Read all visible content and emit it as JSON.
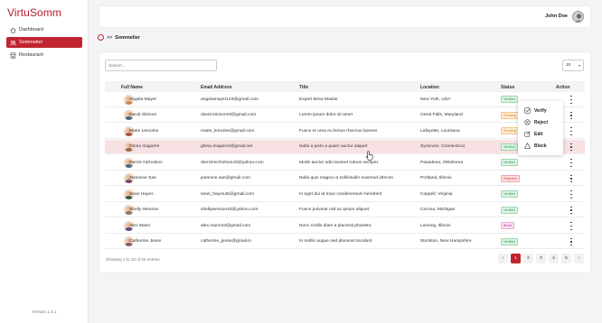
{
  "app": {
    "brand": "VirtuSomm",
    "version": "Version 1.3.1"
  },
  "sidebar": {
    "items": [
      {
        "label": "Dashboard",
        "icon": "home-icon",
        "active": false
      },
      {
        "label": "Sommelier",
        "icon": "users-icon",
        "active": true
      },
      {
        "label": "Restaurant",
        "icon": "store-icon",
        "active": false
      }
    ]
  },
  "header": {
    "user_name": "John Doe"
  },
  "breadcrumb": {
    "separator": ">>",
    "current": "Sommelier"
  },
  "table": {
    "search_placeholder": "Search...",
    "page_size": "10",
    "columns": [
      "Full Name",
      "Email Address",
      "Title",
      "Location",
      "Status",
      "Action"
    ],
    "rows": [
      {
        "name": "Angela Mayer",
        "email": "angelamayer143@gmail.com",
        "title": "Expert Brew Master",
        "location": "New York, USA",
        "status": "Verified"
      },
      {
        "name": "David Stinson",
        "email": "david.stinson19@gmail.com",
        "title": "Lorem ipsum dolor sit amet",
        "location": "Great Falls, Maryland",
        "status": "Pending"
      },
      {
        "name": "Marie Lemoine",
        "email": "marie_lemoine@gmail.com",
        "title": "Fusce et urna eu lectus rhoncus laoreet",
        "location": "Lafayette, Louisiana",
        "status": "Pending"
      },
      {
        "name": "Gloria Izaguirre",
        "email": "gloria-izaguirre@gmail.net",
        "title": "Nulla a justo a quam auctor aliquet",
        "location": "Syracuse, Connecticut",
        "status": "Verified"
      },
      {
        "name": "Derick Nicholson",
        "email": "derricknicholson43@yahoo.com",
        "title": "Morbi auctor odio laoreet rutrum semper",
        "location": "Pasadena, Oklahoma",
        "status": "Verified"
      },
      {
        "name": "Jeannine Sae",
        "email": "jeannine.sae@gmail.com",
        "title": "Nulla quis magna ut sollicitudin euismod ultrices",
        "location": "Portland, Illinois",
        "status": "Rejected"
      },
      {
        "name": "Sean Hayes",
        "email": "sean_hayes45@gmail.com",
        "title": "In eget dui at risus condimentum hendrerit",
        "location": "Coppell, Virginia",
        "status": "Verified"
      },
      {
        "name": "Shelly Wesson",
        "email": "shellywesson43@yahoo.com",
        "title": "Fusce pulvinar nisl ac ipsum aliquet",
        "location": "Corona, Michigan",
        "status": "Verified"
      },
      {
        "name": "Alex Mann",
        "email": "alex.mann43@gmail.com",
        "title": "Nunc mollis diam a placerat pharetra",
        "location": "Lansing, Illinois",
        "status": "Block"
      },
      {
        "name": "Catherine Jesse",
        "email": "catherine_jesse@gmail.in",
        "title": "In mollis augue sed placerat tincidunt",
        "location": "Stockton, New Hampshire",
        "status": "Verified"
      }
    ],
    "footer": "Showing 1 to 10 of 50 entries"
  },
  "action_menu": [
    {
      "label": "Verify",
      "icon": "check-square-icon"
    },
    {
      "label": "Reject",
      "icon": "x-circle-icon"
    },
    {
      "label": "Edit",
      "icon": "edit-icon"
    },
    {
      "label": "Block",
      "icon": "warning-icon"
    }
  ],
  "pagination": {
    "prev": "‹",
    "pages": [
      "1",
      "2",
      "3",
      "4",
      "5"
    ],
    "next": "›",
    "current": "1"
  },
  "colors": {
    "brand": "#c0242f",
    "highlight_row": "#f8e1e3"
  }
}
